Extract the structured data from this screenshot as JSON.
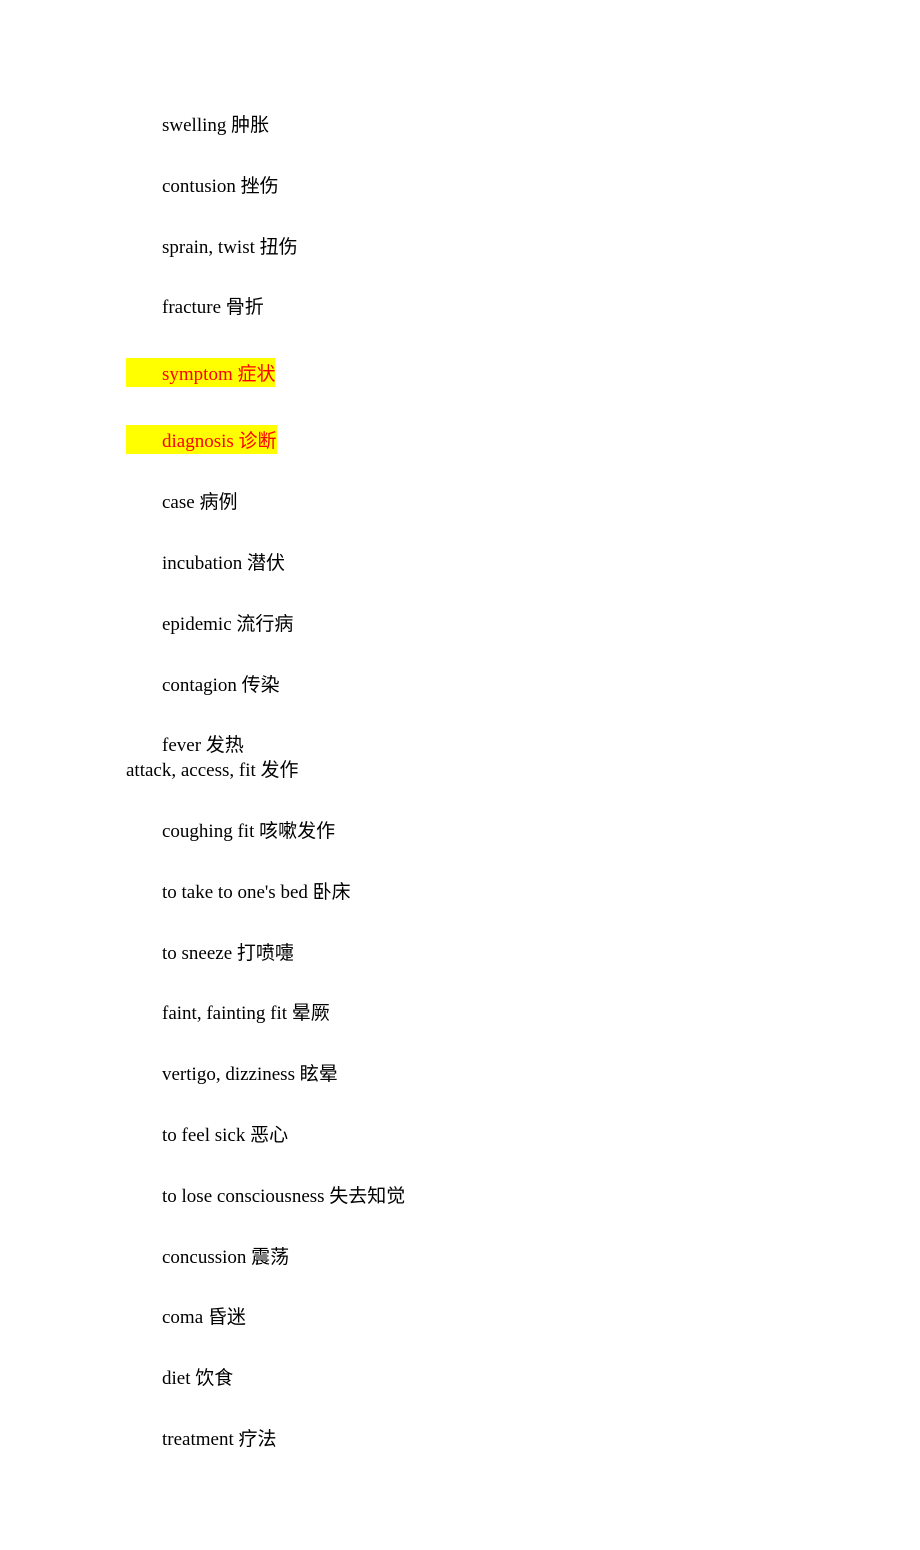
{
  "lines": [
    {
      "text": "swelling  肿胀",
      "style": "indent",
      "highlight": false,
      "tight": false
    },
    {
      "text": "contusion  挫伤",
      "style": "indent",
      "highlight": false,
      "tight": false
    },
    {
      "text": "sprain, twist  扭伤",
      "style": "indent",
      "highlight": false,
      "tight": false
    },
    {
      "text": "fracture  骨折",
      "style": "indent",
      "highlight": false,
      "tight": false
    },
    {
      "text": "symptom  症状",
      "style": "hl",
      "highlight": true,
      "tight": false
    },
    {
      "text": "diagnosis  诊断",
      "style": "hl",
      "highlight": true,
      "tight": false
    },
    {
      "text": "case  病例",
      "style": "indent",
      "highlight": false,
      "tight": false
    },
    {
      "text": "incubation  潜伏",
      "style": "indent",
      "highlight": false,
      "tight": false
    },
    {
      "text": "epidemic  流行病",
      "style": "indent",
      "highlight": false,
      "tight": false
    },
    {
      "text": "contagion  传染",
      "style": "indent",
      "highlight": false,
      "tight": false
    },
    {
      "text": "fever  发热",
      "style": "indent",
      "highlight": false,
      "tight": true
    },
    {
      "text": "attack, access, fit  发作",
      "style": "no-indent",
      "highlight": false,
      "tight": false
    },
    {
      "text": "coughing fit  咳嗽发作",
      "style": "indent",
      "highlight": false,
      "tight": false
    },
    {
      "text": "to take to one's bed  卧床",
      "style": "indent",
      "highlight": false,
      "tight": false
    },
    {
      "text": "to sneeze  打喷嚏",
      "style": "indent",
      "highlight": false,
      "tight": false
    },
    {
      "text": "faint, fainting fit  晕厥",
      "style": "indent",
      "highlight": false,
      "tight": false
    },
    {
      "text": "vertigo, dizziness  眩晕",
      "style": "indent",
      "highlight": false,
      "tight": false
    },
    {
      "text": "to feel sick  恶心",
      "style": "indent",
      "highlight": false,
      "tight": false
    },
    {
      "text": "to lose consciousness  失去知觉",
      "style": "indent",
      "highlight": false,
      "tight": false
    },
    {
      "text": "concussion  震荡",
      "style": "indent",
      "highlight": false,
      "tight": false
    },
    {
      "text": "coma  昏迷",
      "style": "indent",
      "highlight": false,
      "tight": false
    },
    {
      "text": "diet  饮食",
      "style": "indent",
      "highlight": false,
      "tight": false
    },
    {
      "text": "treatment  疗法",
      "style": "indent",
      "highlight": false,
      "tight": false
    }
  ]
}
